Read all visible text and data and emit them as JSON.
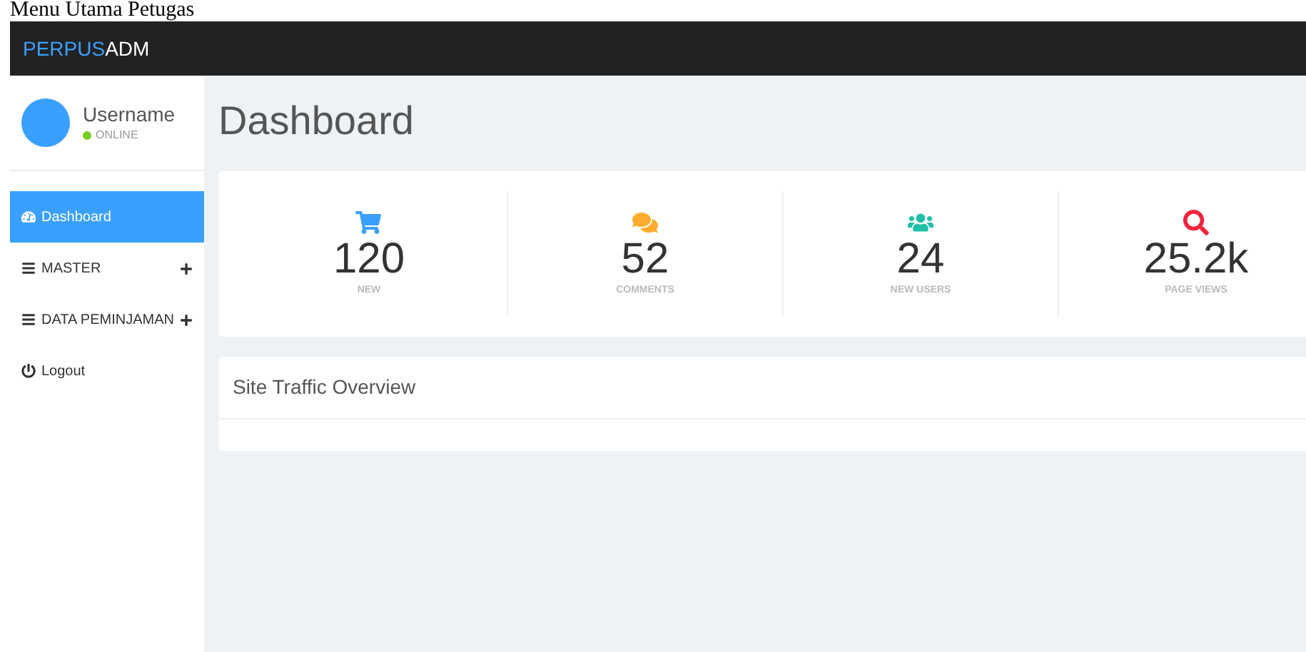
{
  "caption": "Menu Utama Petugas",
  "brand": {
    "part_1": "PERPUS",
    "part_2": "ADM"
  },
  "user": {
    "name": "Username",
    "status": "ONLINE",
    "online": true
  },
  "sidebar": {
    "items": [
      {
        "label": "Dashboard",
        "kind": "dashboard",
        "selected": true,
        "expandable": false
      },
      {
        "label": "MASTER",
        "kind": "list",
        "selected": false,
        "expandable": true
      },
      {
        "label": "DATA PEMINJAMAN",
        "kind": "list",
        "selected": false,
        "expandable": true
      },
      {
        "label": "Logout",
        "kind": "logout",
        "selected": false,
        "expandable": false
      }
    ]
  },
  "page_title": "Dashboard",
  "stats": [
    {
      "kind": "cart",
      "value": "120",
      "label": "NEW",
      "color": "#3aa0ff"
    },
    {
      "kind": "comments",
      "value": "52",
      "label": "COMMENTS",
      "color": "#ffab2e"
    },
    {
      "kind": "users",
      "value": "24",
      "label": "NEW USERS",
      "color": "#1fbfa8"
    },
    {
      "kind": "search",
      "value": "25.2k",
      "label": "PAGE VIEWS",
      "color": "#f0243c"
    }
  ],
  "panel": {
    "title": "Site Traffic Overview"
  }
}
